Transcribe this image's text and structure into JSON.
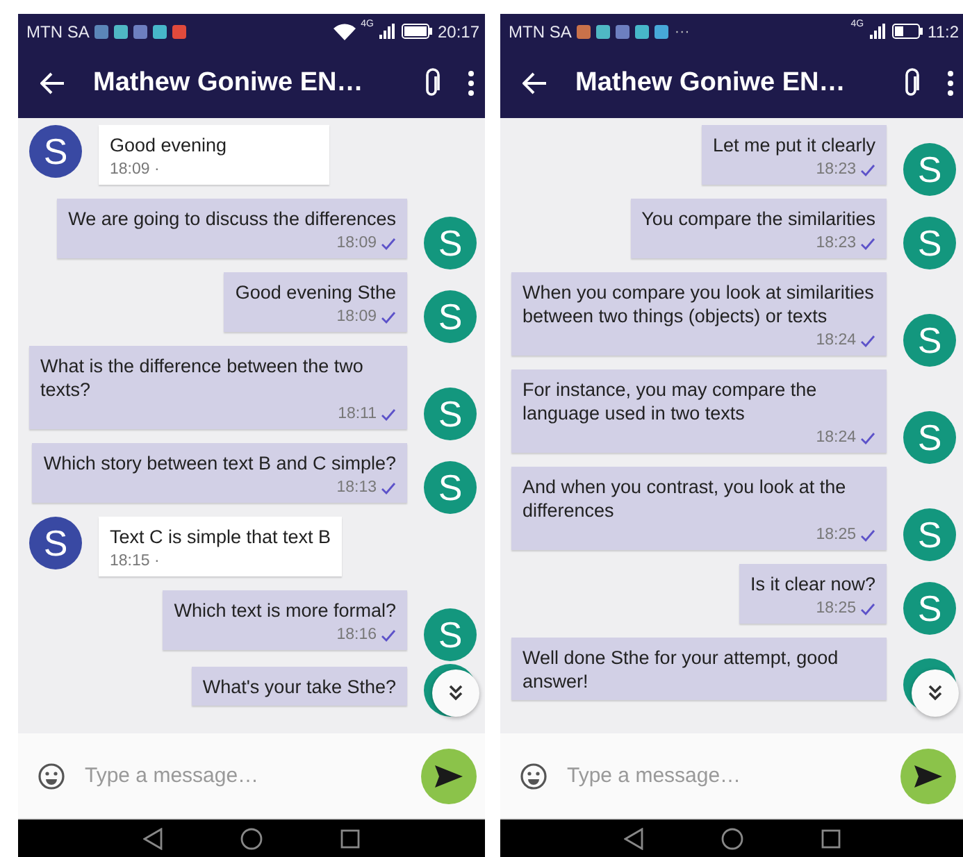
{
  "phones": [
    {
      "status_bar": {
        "carrier": "MTN SA",
        "wifi": true,
        "time": "20:17",
        "network": "4G",
        "notification_icons": [
          {
            "color": "#5b86b8"
          },
          {
            "color": "#4fb8c4"
          },
          {
            "color": "#6d7fc0"
          },
          {
            "color": "#47b7c9"
          },
          {
            "color": "#e04a3c"
          }
        ]
      },
      "header": {
        "title": "Mathew Goniwe EN…"
      },
      "messages": [
        {
          "kind": "incoming",
          "text": "Good evening",
          "time": "18:09 ·",
          "avatar": "S"
        },
        {
          "kind": "outgoing",
          "text": "We are going to discuss the differences",
          "time": "18:09",
          "avatar": "S"
        },
        {
          "kind": "outgoing",
          "text": "Good evening Sthe",
          "time": "18:09",
          "avatar": "S"
        },
        {
          "kind": "outgoing",
          "text": "What is the difference between the two texts?",
          "time": "18:11",
          "avatar": "S"
        },
        {
          "kind": "outgoing",
          "text": "Which story between text B and C simple?",
          "time": "18:13",
          "avatar": "S"
        },
        {
          "kind": "incoming",
          "text": "Text C is simple that text B",
          "time": "18:15 ·",
          "avatar": "S"
        },
        {
          "kind": "outgoing",
          "text": "Which text is more formal?",
          "time": "18:16",
          "avatar": "S"
        },
        {
          "kind": "outgoing",
          "text": "What's your take Sthe?"
        }
      ],
      "composer": {
        "placeholder": "Type a message…"
      }
    },
    {
      "status_bar": {
        "carrier": "MTN SA",
        "wifi": false,
        "more": "···",
        "time": "11:2",
        "network": "4G",
        "notification_icons": [
          {
            "color": "#c9714a"
          },
          {
            "color": "#4fb8c4"
          },
          {
            "color": "#6d7fc0"
          },
          {
            "color": "#47b7c9"
          },
          {
            "color": "#47a9d9"
          }
        ]
      },
      "header": {
        "title": "Mathew Goniwe EN…"
      },
      "messages": [
        {
          "kind": "outgoing",
          "text": "Let me put it clearly",
          "time": "18:23",
          "avatar": "S"
        },
        {
          "kind": "outgoing",
          "text": "You compare the similarities",
          "time": "18:23",
          "avatar": "S"
        },
        {
          "kind": "outgoing",
          "text": "When you compare you look at similarities between two things (objects) or texts",
          "time": "18:24",
          "avatar": "S"
        },
        {
          "kind": "outgoing",
          "text": "For instance, you may compare the language used in two texts",
          "time": "18:24",
          "avatar": "S"
        },
        {
          "kind": "outgoing",
          "text": "And when you contrast, you look at the differences",
          "time": "18:25",
          "avatar": "S"
        },
        {
          "kind": "outgoing",
          "text": "Is it clear now?",
          "time": "18:25",
          "avatar": "S"
        },
        {
          "kind": "outgoing",
          "text": "Well done Sthe for your attempt, good answer!"
        }
      ],
      "composer": {
        "placeholder": "Type a message…"
      }
    }
  ]
}
